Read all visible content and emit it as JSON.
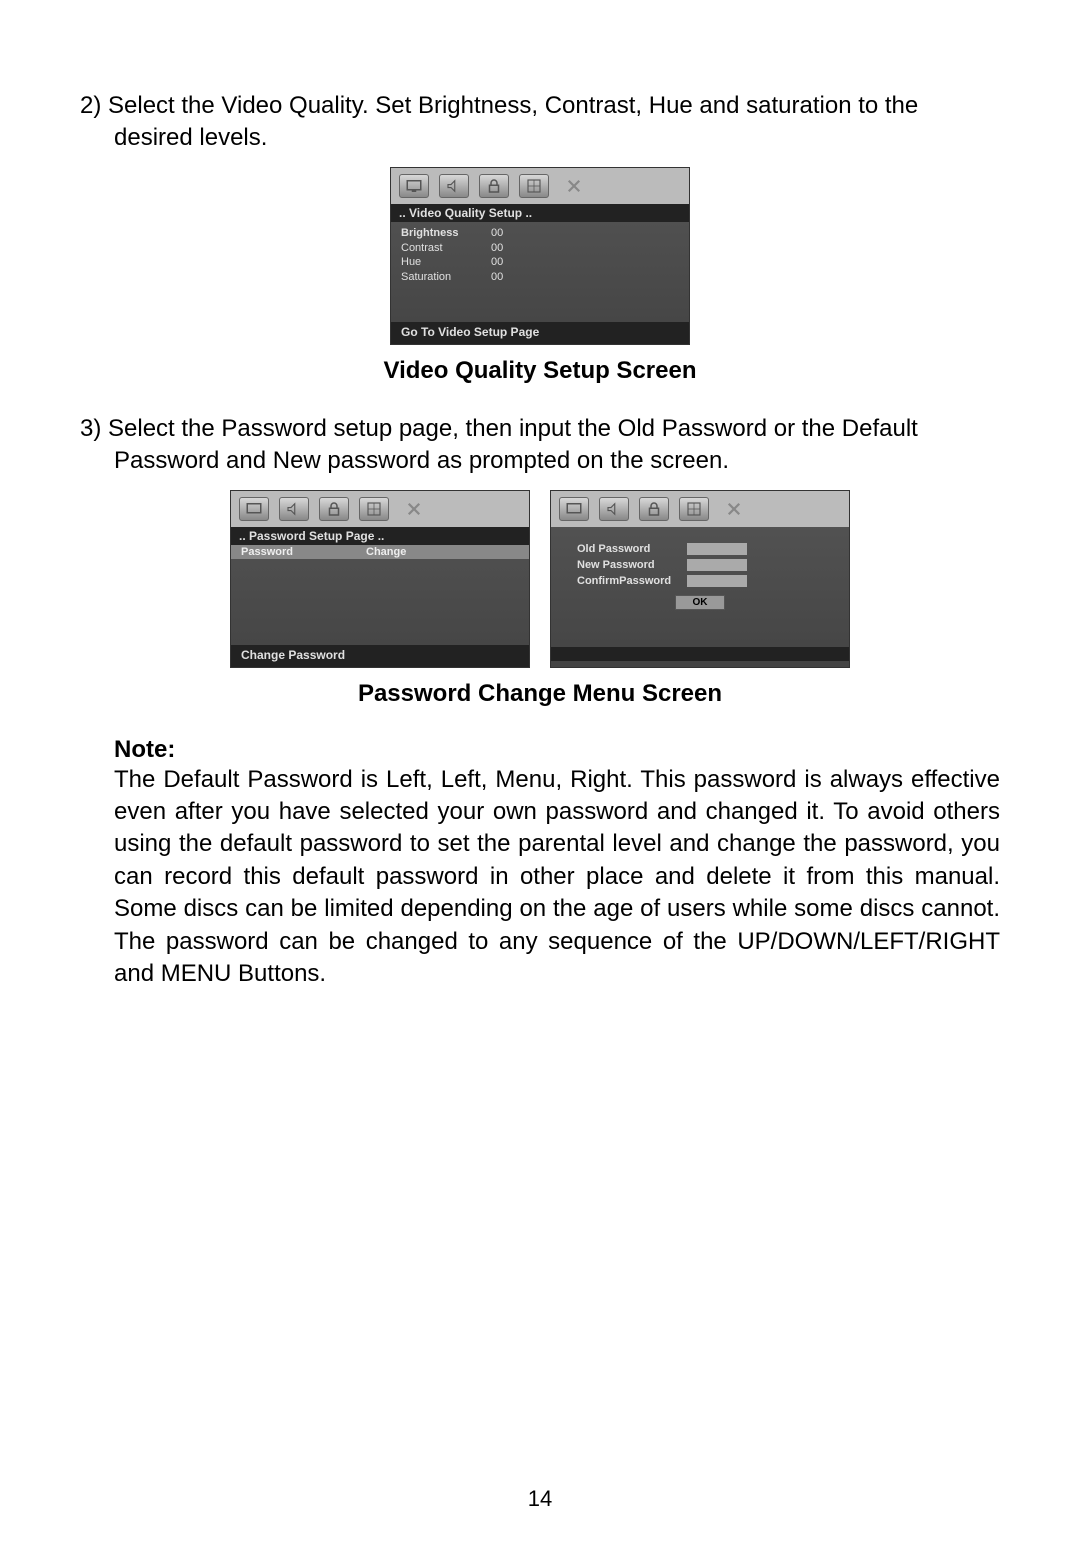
{
  "step2": "2) Select the Video Quality. Set Brightness, Contrast, Hue and saturation to the desired levels.",
  "caption1": "Video Quality Setup Screen",
  "step3": "3) Select  the Password setup page, then input the Old Password or the Default Password and New password as prompted on the screen.",
  "caption2": "Password Change Menu Screen",
  "note_label": "Note:",
  "note_body": "The Default Password is Left, Left, Menu, Right. This password is always effective even after you have selected your own password and changed it. To avoid others using the default password to set the parental level and change the password, you can record this default password in other place and delete it from this manual. Some discs can be limited depending on the age of users while some discs cannot. The password can be changed to any sequence of the UP/DOWN/LEFT/RIGHT and MENU Buttons.",
  "page_number": "14",
  "vq_panel": {
    "title": "..   Video   Quality   Setup   ..",
    "items": [
      {
        "label": "Brightness",
        "value": "00"
      },
      {
        "label": "Contrast",
        "value": "00"
      },
      {
        "label": "Hue",
        "value": "00"
      },
      {
        "label": "Saturation",
        "value": "00"
      }
    ],
    "footer": "Go  To  Video  Setup  Page"
  },
  "pw_panel_left": {
    "title": "..   Password   Setup   Page   ..",
    "item_label": "Password",
    "item_value": "Change",
    "footer": "Change  Password"
  },
  "pw_panel_right": {
    "fields": {
      "old": "Old  Password",
      "new": "New  Password",
      "confirm": "ConfirmPassword"
    },
    "ok": "OK"
  }
}
